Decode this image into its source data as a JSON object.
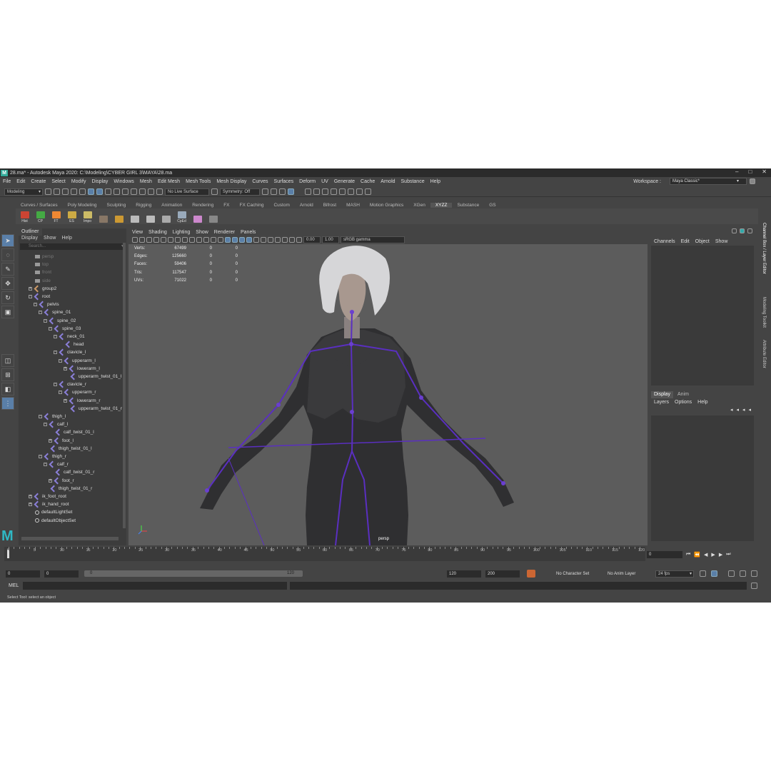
{
  "window": {
    "title": "28.ma* - Autodesk Maya 2020: C:\\Modeling\\CYBER GIRL 3\\MAYA\\28.ma",
    "logo": "M",
    "minimize": "–",
    "maximize": "□",
    "close": "✕"
  },
  "menubar": {
    "items": [
      "File",
      "Edit",
      "Create",
      "Select",
      "Modify",
      "Display",
      "Windows",
      "Mesh",
      "Edit Mesh",
      "Mesh Tools",
      "Mesh Display",
      "Curves",
      "Surfaces",
      "Deform",
      "UV",
      "Generate",
      "Cache",
      "Arnold",
      "Substance",
      "Help"
    ],
    "workspace_label": "Workspace :",
    "workspace_value": "Maya Classic*"
  },
  "statusline": {
    "mode": "Modeling",
    "live_surface": "No Live Surface",
    "symmetry": "Symmetry: Off"
  },
  "shelf": {
    "tabs": [
      "Curves / Surfaces",
      "Poly Modeling",
      "Sculpting",
      "Rigging",
      "Animation",
      "Rendering",
      "FX",
      "FX Caching",
      "Custom",
      "Arnold",
      "Bifrost",
      "MASH",
      "Motion Graphics",
      "XGen",
      "XYZZ",
      "Substance",
      "GS"
    ],
    "selected_tab": "XYZZ",
    "buttons": [
      "Hist",
      "CP",
      "FT",
      "ES",
      "Impo",
      "",
      "",
      "",
      "",
      "",
      "CpEd",
      "",
      ""
    ]
  },
  "outliner": {
    "tab": "Outliner",
    "menu": [
      "Display",
      "Show",
      "Help"
    ],
    "search_placeholder": "Search...",
    "rows": [
      {
        "label": "persp",
        "type": "camera",
        "depth": 0,
        "dim": true
      },
      {
        "label": "top",
        "type": "camera",
        "depth": 0,
        "dim": true
      },
      {
        "label": "front",
        "type": "camera",
        "depth": 0,
        "dim": true
      },
      {
        "label": "side",
        "type": "camera",
        "depth": 0,
        "dim": true
      },
      {
        "label": "group2",
        "type": "group",
        "depth": 0,
        "expander": "+"
      },
      {
        "label": "root",
        "type": "joint",
        "depth": 0,
        "expander": "-"
      },
      {
        "label": "pelvis",
        "type": "joint",
        "depth": 1,
        "expander": "-"
      },
      {
        "label": "spine_01",
        "type": "joint",
        "depth": 2,
        "expander": "-"
      },
      {
        "label": "spine_02",
        "type": "joint",
        "depth": 3,
        "expander": "-"
      },
      {
        "label": "spine_03",
        "type": "joint",
        "depth": 4,
        "expander": "-"
      },
      {
        "label": "neck_01",
        "type": "joint",
        "depth": 5,
        "expander": "-"
      },
      {
        "label": "head",
        "type": "joint",
        "depth": 6
      },
      {
        "label": "clavicle_l",
        "type": "joint",
        "depth": 5,
        "expander": "-"
      },
      {
        "label": "upperarm_l",
        "type": "joint",
        "depth": 6,
        "expander": "-"
      },
      {
        "label": "lowerarm_l",
        "type": "joint",
        "depth": 7,
        "expander": "+"
      },
      {
        "label": "upperarm_twist_01_l",
        "type": "joint",
        "depth": 7
      },
      {
        "label": "clavicle_r",
        "type": "joint",
        "depth": 5,
        "expander": "-"
      },
      {
        "label": "upperarm_r",
        "type": "joint",
        "depth": 6,
        "expander": "-"
      },
      {
        "label": "lowerarm_r",
        "type": "joint",
        "depth": 7,
        "expander": "+"
      },
      {
        "label": "upperarm_twist_01_r",
        "type": "joint",
        "depth": 7
      },
      {
        "label": "thigh_l",
        "type": "joint",
        "depth": 2,
        "expander": "-"
      },
      {
        "label": "calf_l",
        "type": "joint",
        "depth": 3,
        "expander": "-"
      },
      {
        "label": "calf_twist_01_l",
        "type": "joint",
        "depth": 4
      },
      {
        "label": "foot_l",
        "type": "joint",
        "depth": 4,
        "expander": "+"
      },
      {
        "label": "thigh_twist_01_l",
        "type": "joint",
        "depth": 3
      },
      {
        "label": "thigh_r",
        "type": "joint",
        "depth": 2,
        "expander": "-"
      },
      {
        "label": "calf_r",
        "type": "joint",
        "depth": 3,
        "expander": "-"
      },
      {
        "label": "calf_twist_01_r",
        "type": "joint",
        "depth": 4
      },
      {
        "label": "foot_r",
        "type": "joint",
        "depth": 4,
        "expander": "+"
      },
      {
        "label": "thigh_twist_01_r",
        "type": "joint",
        "depth": 3
      },
      {
        "label": "ik_foot_root",
        "type": "joint",
        "depth": 0,
        "expander": "+"
      },
      {
        "label": "ik_hand_root",
        "type": "joint",
        "depth": 0,
        "expander": "+"
      },
      {
        "label": "defaultLightSet",
        "type": "set",
        "depth": 0
      },
      {
        "label": "defaultObjectSet",
        "type": "set",
        "depth": 0
      }
    ]
  },
  "viewport": {
    "menu": [
      "View",
      "Shading",
      "Lighting",
      "Show",
      "Renderer",
      "Panels"
    ],
    "exposure": "0.00",
    "gamma": "1.00",
    "color_space": "sRGB gamma",
    "camera_label": "persp",
    "hud": [
      {
        "label": "Verts:",
        "v1": "67499",
        "v2": "0",
        "v3": "0"
      },
      {
        "label": "Edges:",
        "v1": "125660",
        "v2": "0",
        "v3": "0"
      },
      {
        "label": "Faces:",
        "v1": "59406",
        "v2": "0",
        "v3": "0"
      },
      {
        "label": "Tris:",
        "v1": "117547",
        "v2": "0",
        "v3": "0"
      },
      {
        "label": "UVs:",
        "v1": "71022",
        "v2": "0",
        "v3": "0"
      }
    ]
  },
  "channelbox": {
    "menu": [
      "Channels",
      "Edit",
      "Object",
      "Show"
    ],
    "layer_tabs": [
      "Display",
      "Anim"
    ],
    "layer_menu": [
      "Layers",
      "Options",
      "Help"
    ]
  },
  "side_tabs": [
    "Modeling Toolkit",
    "Attribute Editor",
    "Channel Box / Layer Editor"
  ],
  "timeline": {
    "ticks": [
      "0",
      "5",
      "10",
      "15",
      "20",
      "25",
      "30",
      "35",
      "40",
      "45",
      "50",
      "55",
      "60",
      "65",
      "70",
      "75",
      "80",
      "85",
      "90",
      "95",
      "100",
      "105",
      "110",
      "115",
      "120"
    ],
    "current_frame": "0"
  },
  "range": {
    "start": "0",
    "inner_start": "0",
    "slider_start": "0",
    "slider_end": "120",
    "inner_end": "120",
    "end": "200",
    "character_set": "No Character Set",
    "anim_layer": "No Anim Layer",
    "fps": "24 fps"
  },
  "command": {
    "label": "MEL",
    "help": "Select Tool: select an object"
  },
  "colors": {
    "joint": "#6a3fd0",
    "bg": "#444444",
    "viewport": "#5c5c5c"
  }
}
